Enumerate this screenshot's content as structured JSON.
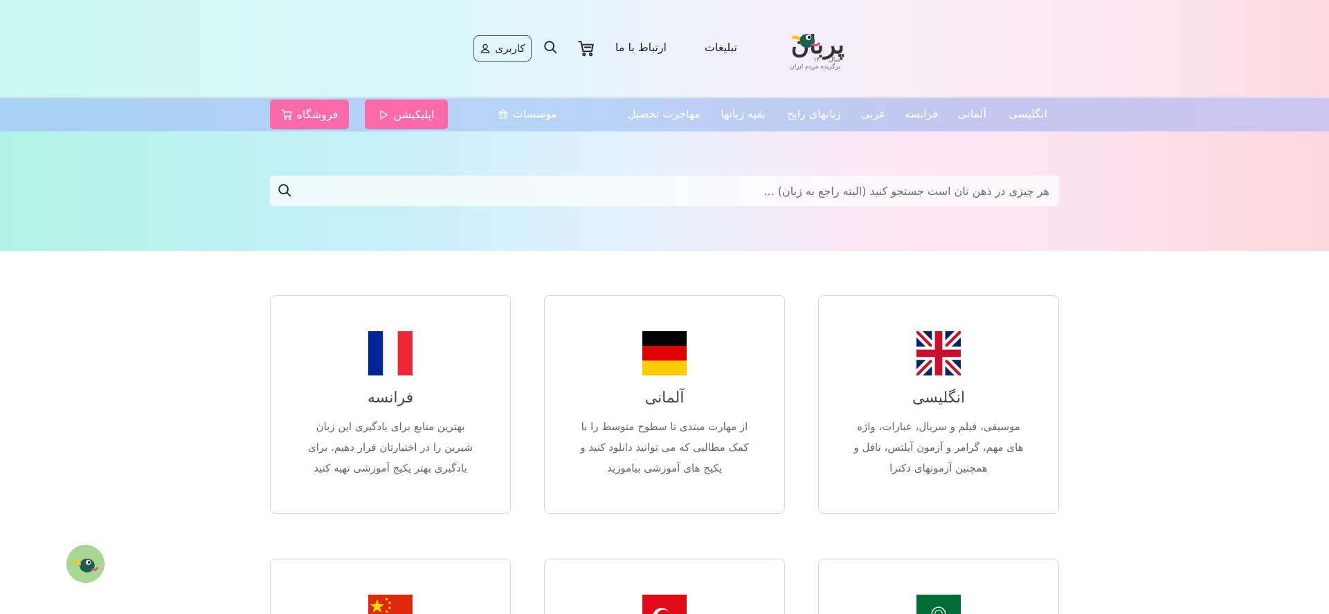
{
  "header": {
    "logo": {
      "word": "پربان",
      "tag": "سال ۱۴۰۰",
      "subtitle": "برگزیده مردم ایران"
    },
    "nav": {
      "ads": "تبلیغات",
      "contact": "ارتباط با ما"
    },
    "user_button": "کاربری",
    "icons": [
      "cart-icon",
      "search-icon",
      "user-icon"
    ]
  },
  "menu": {
    "items": {
      "english": "انگلیسی",
      "german": "آلمانی",
      "french": "فرانسه",
      "arabic": "عربی",
      "common": "زبانهای رایج",
      "other": "بقیه زبانها",
      "migration": "مهاجرت تحصیل"
    },
    "institutes": "موسسات",
    "app_button": "اپلیکیشن",
    "shop_button": "فروشگاه"
  },
  "search": {
    "placeholder": "هر چیزی در ذهن تان است جستجو کنید (البته راجع به زبان) ..."
  },
  "cards": [
    {
      "title": "انگلیسی",
      "description": "موسیقی، فیلم و سریال، عبارات، واژه های مهم، گرامر و آزمون آیلتس، تافل و همچنین آزمونهای دکترا",
      "flag": "uk-flag"
    },
    {
      "title": "آلمانی",
      "description": "از مهارت مبتدی تا سطوح متوسط را با کمک مطالبی که می توانید دانلود کنید و پکیج های آموزشی بیاموزید",
      "flag": "germany-flag"
    },
    {
      "title": "فرانسه",
      "description": "بهترین منابع برای یادگیری این زبان شیرین را در اختیارتان قرار دهیم. برای یادگیری بهتر پکیج آموزشی تهیه کنید",
      "flag": "france-flag"
    },
    {
      "flag": "saudi-flag"
    },
    {
      "flag": "turkey-flag"
    },
    {
      "flag": "china-flag"
    }
  ],
  "colors": {
    "accent_pink": "#fc6ba9",
    "chat_green": "#a7d792",
    "menu_text": "#ffffff"
  }
}
